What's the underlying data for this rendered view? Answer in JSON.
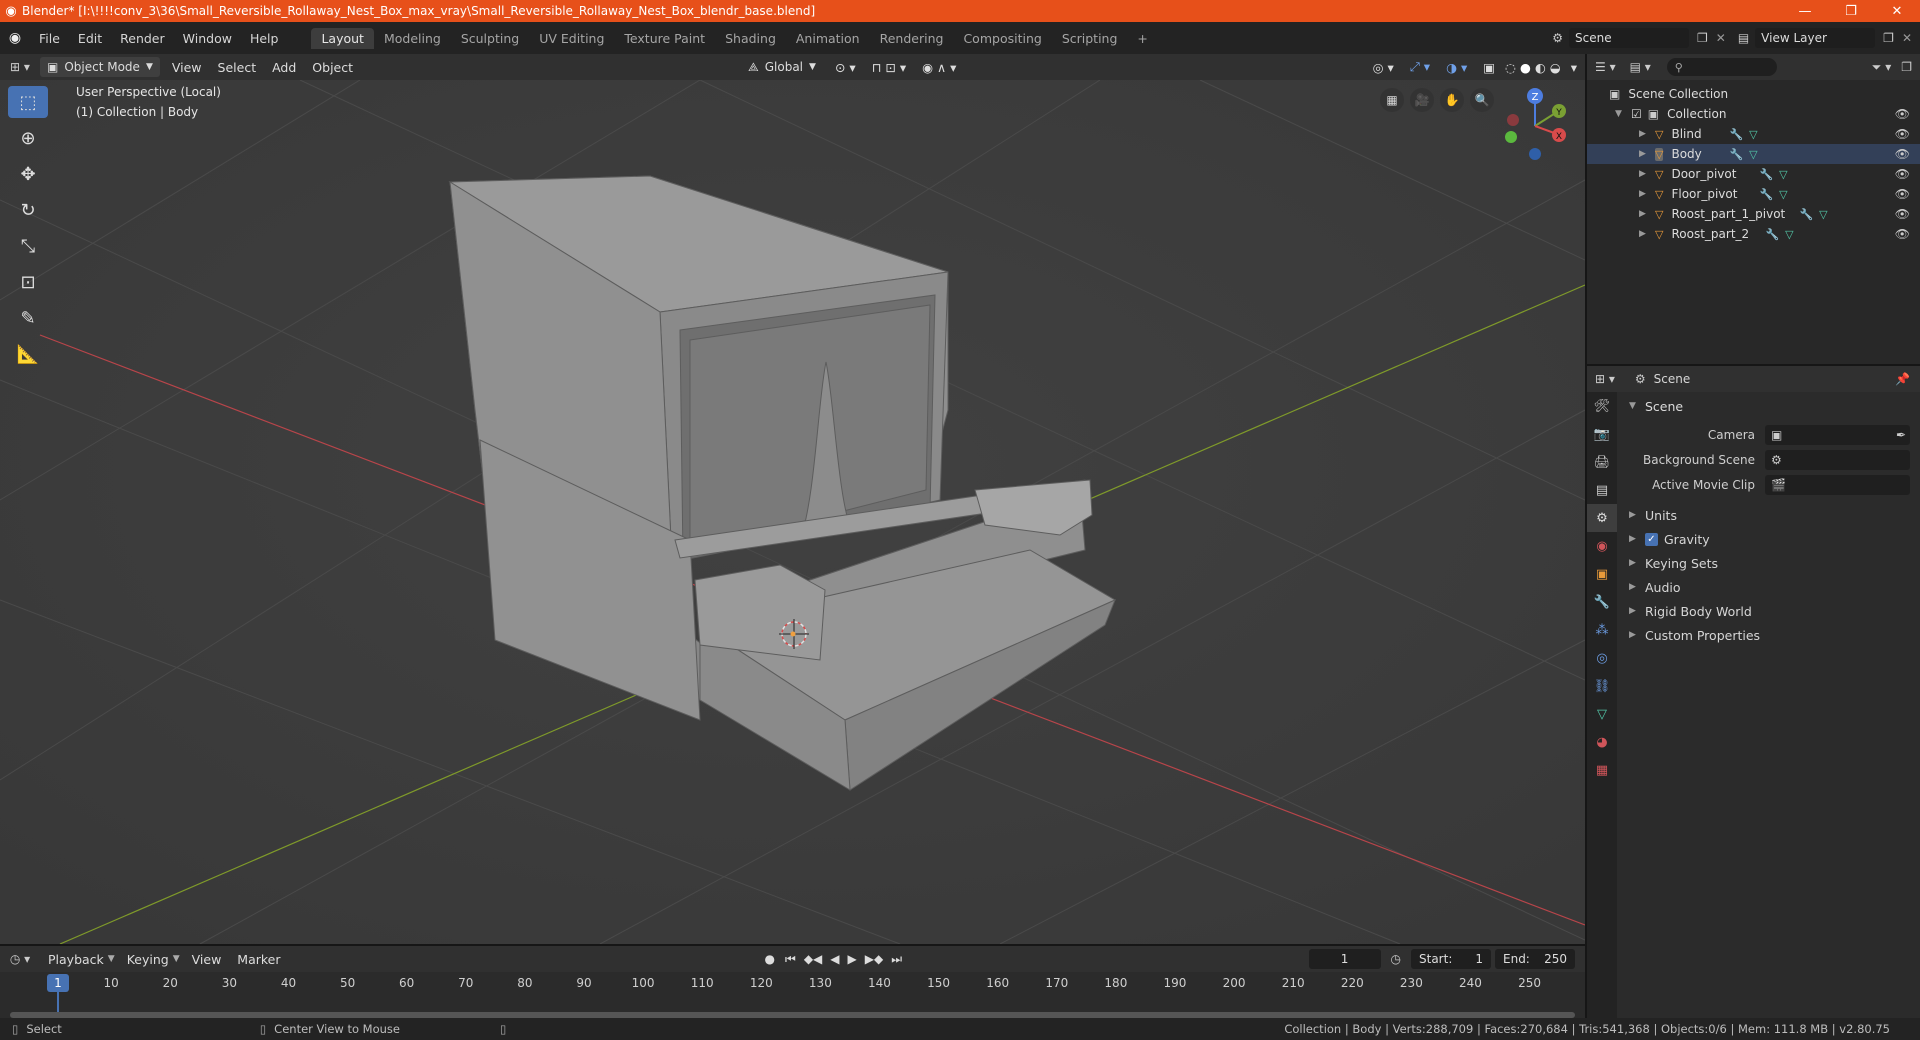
{
  "window": {
    "title": "Blender* [I:\\!!!!conv_3\\36\\Small_Reversible_Rollaway_Nest_Box_max_vray\\Small_Reversible_Rollaway_Nest_Box_blendr_base.blend]",
    "minimize": "—",
    "maximize": "❐",
    "close": "✕"
  },
  "menu": [
    "File",
    "Edit",
    "Render",
    "Window",
    "Help"
  ],
  "workspaces": [
    "Layout",
    "Modeling",
    "Sculpting",
    "UV Editing",
    "Texture Paint",
    "Shading",
    "Animation",
    "Rendering",
    "Compositing",
    "Scripting"
  ],
  "workspace_add": "+",
  "scene_name": "Scene",
  "view_layer": "View Layer",
  "viewport_header": {
    "mode": "Object Mode",
    "menus": [
      "View",
      "Select",
      "Add",
      "Object"
    ],
    "transform": "Global"
  },
  "viewport": {
    "perspective": "User Perspective (Local)",
    "context": "(1) Collection | Body",
    "gizmo": {
      "z": "Z",
      "y": "Y",
      "x": "X"
    }
  },
  "outliner": {
    "scene_collection": "Scene Collection",
    "collection": "Collection",
    "objects": [
      "Blind",
      "Body",
      "Door_pivot",
      "Floor_pivot",
      "Roost_part_1_pivot",
      "Roost_part_2"
    ]
  },
  "properties": {
    "header": "Scene",
    "panel": "Scene",
    "camera_label": "Camera",
    "background_label": "Background Scene",
    "movieclip_label": "Active Movie Clip",
    "sections": [
      "Units",
      "Gravity",
      "Keying Sets",
      "Audio",
      "Rigid Body World",
      "Custom Properties"
    ]
  },
  "timeline": {
    "menus": [
      "Playback",
      "Keying",
      "View",
      "Marker"
    ],
    "current_frame": "1",
    "start_label": "Start:",
    "start": "1",
    "end_label": "End:",
    "end": "250",
    "ticks": [
      "1",
      "10",
      "20",
      "30",
      "40",
      "50",
      "60",
      "70",
      "80",
      "90",
      "100",
      "110",
      "120",
      "130",
      "140",
      "150",
      "160",
      "170",
      "180",
      "190",
      "200",
      "210",
      "220",
      "230",
      "240",
      "250"
    ]
  },
  "statusbar": {
    "select": "Select",
    "center_view": "Center View to Mouse",
    "stats": "Collection | Body | Verts:288,709 | Faces:270,684 | Tris:541,368 | Objects:0/6 | Mem: 111.8 MB | v2.80.75"
  },
  "colors": {
    "titlebar": "#e7501a",
    "accent": "#4772b3",
    "x_axis": "#b8454a",
    "y_axis": "#7f9a2a"
  }
}
